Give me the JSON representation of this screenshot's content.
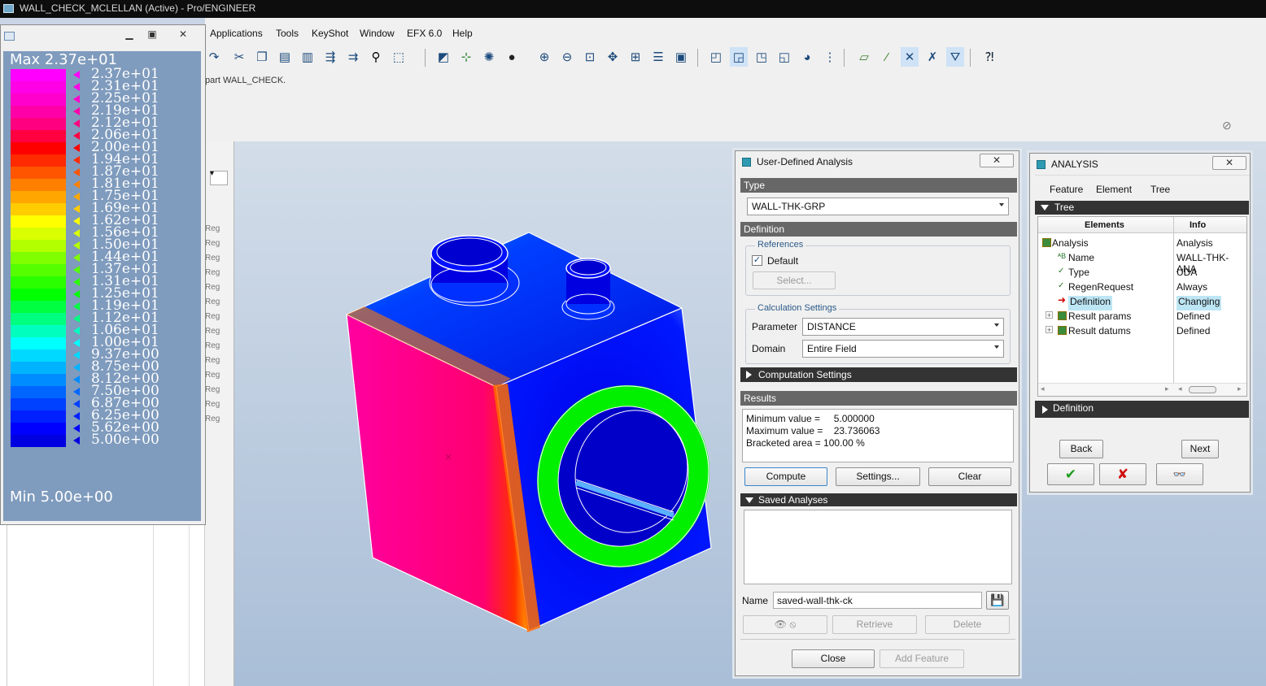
{
  "window": {
    "title": "WALL_CHECK_MCLELLAN (Active) - Pro/ENGINEER"
  },
  "menu": [
    "Applications",
    "Tools",
    "KeyShot",
    "Window",
    "EFX 6.0",
    "Help"
  ],
  "message": "part WALL_CHECK.",
  "leftpanel": {
    "row_text": "Reg"
  },
  "legend": {
    "max_label": "Max 2.37e+01",
    "min_label": "Min 5.00e+00",
    "levels": [
      "2.37e+01",
      "2.31e+01",
      "2.25e+01",
      "2.19e+01",
      "2.12e+01",
      "2.06e+01",
      "2.00e+01",
      "1.94e+01",
      "1.87e+01",
      "1.81e+01",
      "1.75e+01",
      "1.69e+01",
      "1.62e+01",
      "1.56e+01",
      "1.50e+01",
      "1.44e+01",
      "1.37e+01",
      "1.31e+01",
      "1.25e+01",
      "1.19e+01",
      "1.12e+01",
      "1.06e+01",
      "1.00e+01",
      "9.37e+00",
      "8.75e+00",
      "8.12e+00",
      "7.50e+00",
      "6.87e+00",
      "6.25e+00",
      "5.62e+00",
      "5.00e+00"
    ],
    "colors": [
      "#ff00ff",
      "#ff00e6",
      "#ff00cc",
      "#ff00a8",
      "#ff0080",
      "#ff0040",
      "#ff0000",
      "#ff2a00",
      "#ff5500",
      "#ff8000",
      "#ffa600",
      "#ffcc00",
      "#ffff00",
      "#d9ff00",
      "#b3ff00",
      "#80ff00",
      "#55ff00",
      "#2aff00",
      "#00ff00",
      "#00ff40",
      "#00ff80",
      "#00ffbf",
      "#00ffff",
      "#00d9ff",
      "#00b3ff",
      "#008cff",
      "#0066ff",
      "#0040ff",
      "#0020ff",
      "#0000ff",
      "#0000e0"
    ]
  },
  "uda": {
    "title": "User-Defined Analysis",
    "close_glyph": "✕",
    "type_header": "Type",
    "type_value": "WALL-THK-GRP",
    "definition_header": "Definition",
    "references_label": "References",
    "default_label": "Default",
    "default_checked": true,
    "select_label": "Select...",
    "calc_settings_label": "Calculation Settings",
    "parameter_label": "Parameter",
    "parameter_value": "DISTANCE",
    "domain_label": "Domain",
    "domain_value": "Entire Field",
    "computation_settings": "Computation Settings",
    "results_header": "Results",
    "min_line": "Minimum value =     5.000000",
    "max_line": "Maximum value =    23.736063",
    "bracket_line": "Bracketed area = 100.00 %",
    "compute_label": "Compute",
    "settings_label": "Settings...",
    "clear_label": "Clear",
    "saved_header": "Saved Analyses",
    "name_label": "Name",
    "name_value": "saved-wall-thk-ck",
    "retrieve_label": "Retrieve",
    "delete_label": "Delete",
    "close_label": "Close",
    "add_feature_label": "Add Feature"
  },
  "analysis": {
    "title": "ANALYSIS",
    "close_glyph": "✕",
    "menu": [
      "Feature",
      "Element",
      "Tree"
    ],
    "tree_header": "Tree",
    "col_elements": "Elements",
    "col_info": "Info",
    "rows": [
      {
        "element": "Analysis",
        "info": "Analysis"
      },
      {
        "element": "Name",
        "info": "WALL-THK-ANA"
      },
      {
        "element": "Type",
        "info": "UDA"
      },
      {
        "element": "RegenRequest",
        "info": "Always"
      },
      {
        "element": "Definition",
        "info": "Changing"
      },
      {
        "element": "Result params",
        "info": "Defined"
      },
      {
        "element": "Result datums",
        "info": "Defined"
      }
    ],
    "definition_section": "Definition",
    "back_label": "Back",
    "next_label": "Next",
    "ok_glyph": "✔",
    "cancel_glyph": "✘",
    "preview_glyph": "👓"
  }
}
